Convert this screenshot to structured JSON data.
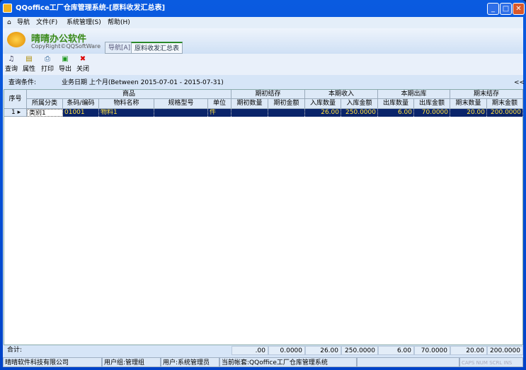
{
  "window": {
    "title": "QQoffice工厂仓库管理系统-[原料收发汇总表]",
    "min": "_",
    "max": "□",
    "close": "✕"
  },
  "menu": [
    "导航",
    "文件(F)",
    "系统管理(S)",
    "帮助(H)"
  ],
  "brand": {
    "name": "晴晴办公软件",
    "copyright": "CopyRight©QQSoftWare"
  },
  "tabs": [
    "导航[A]",
    "原料收发汇总表"
  ],
  "toolbar": [
    "查询",
    "属性",
    "打印",
    "导出",
    "关闭"
  ],
  "query": {
    "label": "查询条件:",
    "value": "业务日期 上个月(Between 2015-07-01 - 2015-07-31)",
    "collapse": "<<"
  },
  "grid": {
    "seq_header": "序号",
    "groups": [
      "商品",
      "期初结存",
      "本期收入",
      "本期出库",
      "期末结存"
    ],
    "columns": [
      "所属分类",
      "条码/编码",
      "物料名称",
      "规格型号",
      "单位",
      "期初数量",
      "期初金额",
      "入库数量",
      "入库金额",
      "出库数量",
      "出库金额",
      "期末数量",
      "期末金额"
    ],
    "rows": [
      {
        "seq": "1",
        "cells": [
          "类别1",
          "01001",
          "物料1",
          "",
          "件",
          "",
          "",
          "26.00",
          "250.0000",
          "6.00",
          "70.0000",
          "20.00",
          "200.0000"
        ]
      }
    ]
  },
  "totals": {
    "label": "合计:",
    "values": [
      ".00",
      "0.0000",
      "26.00",
      "250.0000",
      "6.00",
      "70.0000",
      "20.00",
      "200.0000"
    ]
  },
  "status": [
    "晴晴软件科技有限公司",
    "用户组:管理组",
    "用户:系统管理员",
    "当前帐套:QQoffice工厂仓库管理系统",
    "",
    "CAPS NUM SCRL INS"
  ]
}
